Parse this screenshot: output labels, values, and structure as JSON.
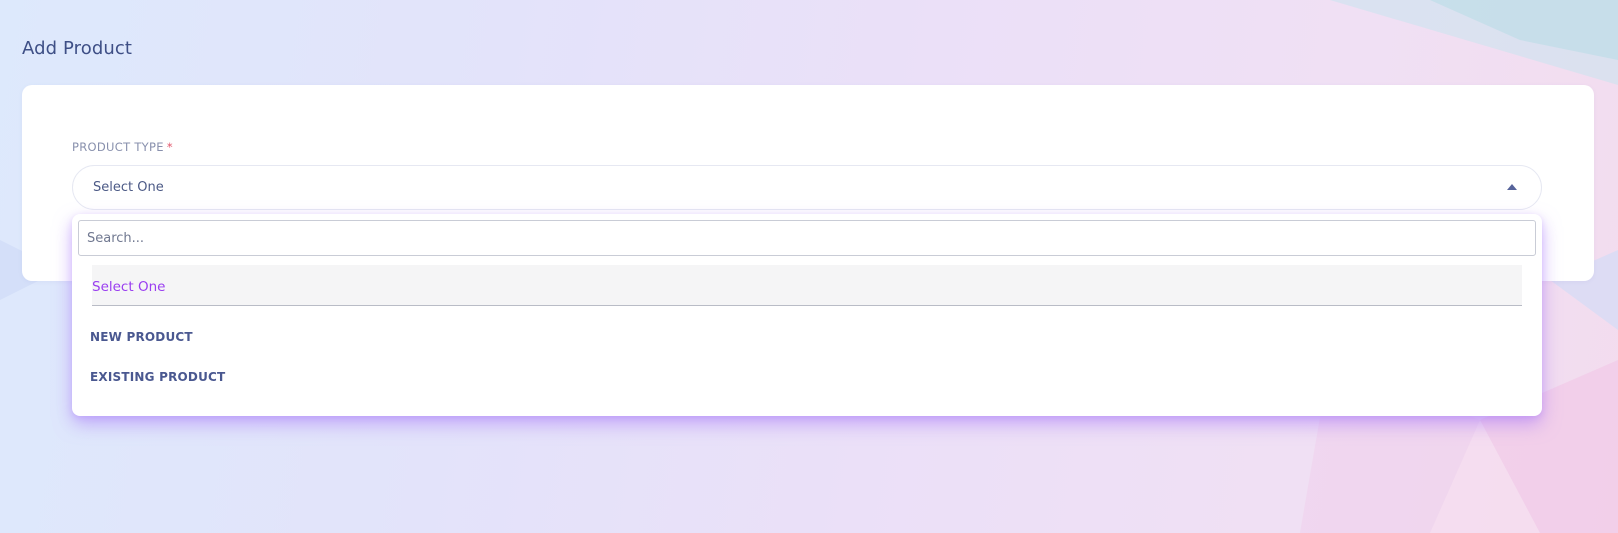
{
  "page": {
    "title": "Add Product"
  },
  "form": {
    "product_type": {
      "label": "PRODUCT TYPE",
      "required_marker": "*",
      "selected_value": "Select One",
      "caret_icon": "caret-up-icon"
    }
  },
  "dropdown": {
    "search_placeholder": "Search...",
    "search_value": "",
    "options": [
      {
        "label": "Select One",
        "selected": true
      },
      {
        "label": "NEW PRODUCT",
        "selected": false
      },
      {
        "label": "EXISTING PRODUCT",
        "selected": false
      }
    ]
  },
  "colors": {
    "accent": "#9a3ef0",
    "title": "#3e4f86",
    "required": "#e2556a",
    "dropdown_glow": "#a876fa"
  }
}
